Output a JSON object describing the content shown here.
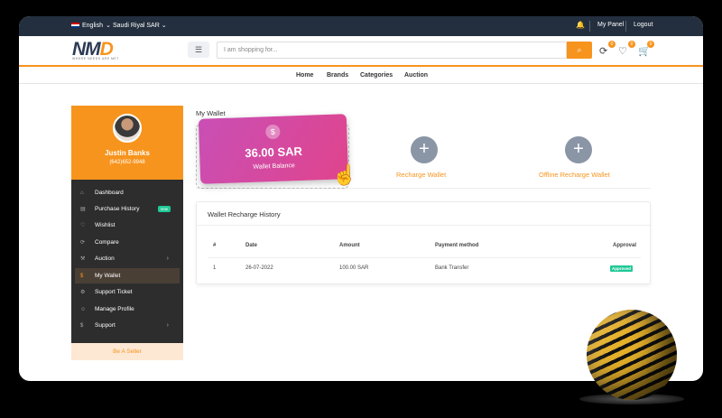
{
  "topbar": {
    "language": "English",
    "currency": "Saudi Riyal SAR",
    "my_panel": "My Panel",
    "logout": "Logout"
  },
  "header": {
    "logo_text_left": "NM",
    "logo_text_right": "D",
    "logo_tagline": "WHERE NEEDS ARE MET",
    "search_placeholder": "I am shopping for...",
    "compare_count": "0",
    "wishlist_count": "0",
    "cart_count": "0"
  },
  "nav": {
    "home": "Home",
    "brands": "Brands",
    "categories": "Categories",
    "auction": "Auction"
  },
  "user": {
    "name": "Justin Banks",
    "phone": "(642)652-9948"
  },
  "sidebar": {
    "items": [
      {
        "label": "Dashboard",
        "icon": "home-icon"
      },
      {
        "label": "Purchase History",
        "icon": "file-icon",
        "badge": "new"
      },
      {
        "label": "Wishlist",
        "icon": "heart-icon"
      },
      {
        "label": "Compare",
        "icon": "refresh-icon"
      },
      {
        "label": "Auction",
        "icon": "gavel-icon"
      },
      {
        "label": "My Wallet",
        "icon": "dollar-icon"
      },
      {
        "label": "Support Ticket",
        "icon": "ticket-icon"
      },
      {
        "label": "Manage Profile",
        "icon": "user-icon"
      },
      {
        "label": "Support",
        "icon": "dollar-icon"
      }
    ],
    "seller": "Be A Seller"
  },
  "wallet": {
    "title": "My Wallet",
    "amount": "36.00 SAR",
    "label": "Wallet Balance",
    "recharge": "Recharge Wallet",
    "offline": "Offline Recharge Wallet"
  },
  "history": {
    "title": "Wallet Recharge History",
    "headers": [
      "#",
      "Date",
      "Amount",
      "Payment method",
      "Approval"
    ],
    "rows": [
      {
        "num": "1",
        "date": "26-07-2022",
        "amount": "100.00 SAR",
        "method": "Bank Transfer",
        "approval": "Approved"
      }
    ]
  },
  "colors": {
    "accent": "#f7941d",
    "topbar": "#232f3e",
    "sidebar": "#2d2d2d",
    "success": "#20c997"
  }
}
